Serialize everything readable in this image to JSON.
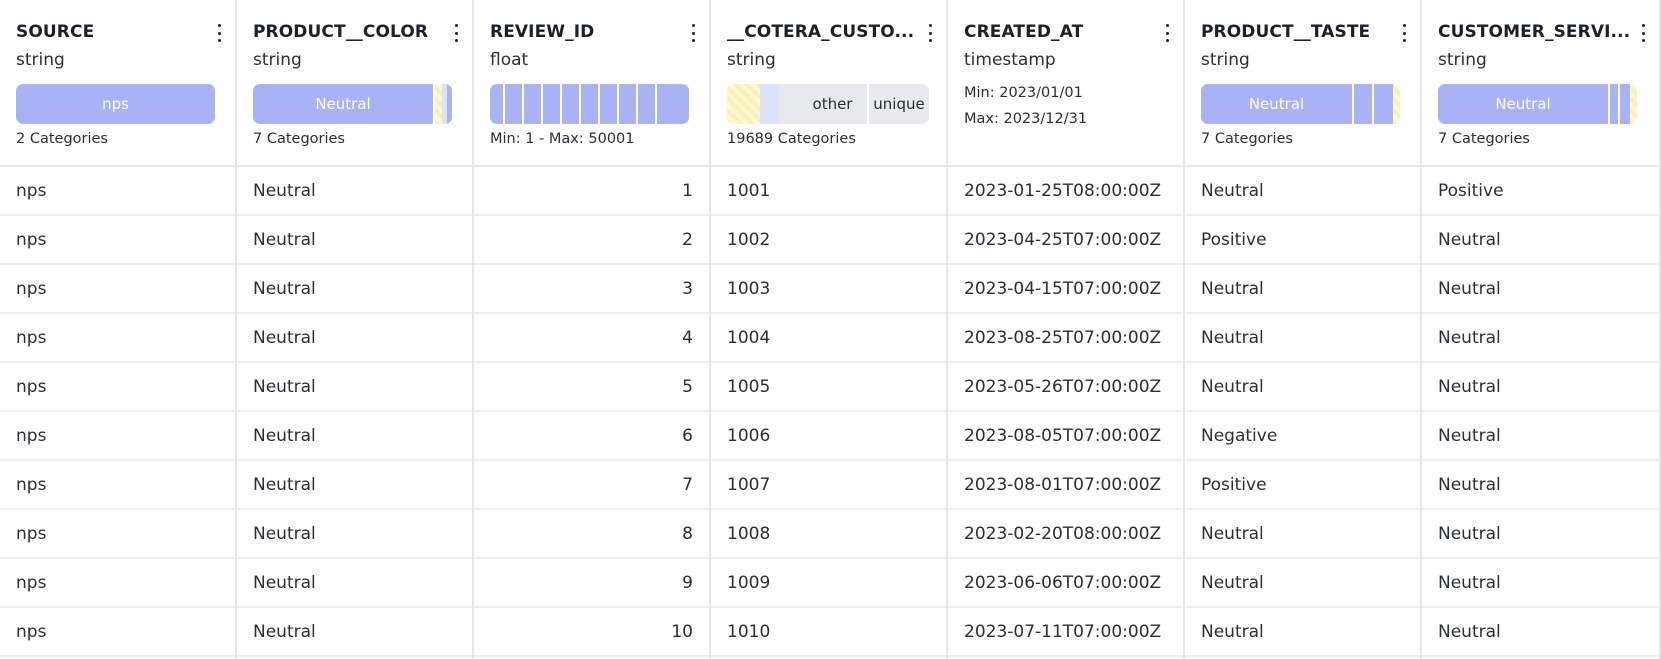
{
  "columns": [
    {
      "name": "SOURCE",
      "type": "string",
      "summary": "2 Categories",
      "bar_label": "nps",
      "values": [
        "nps",
        "nps",
        "nps",
        "nps",
        "nps",
        "nps",
        "nps",
        "nps",
        "nps",
        "nps"
      ]
    },
    {
      "name": "PRODUCT__COLOR",
      "type": "string",
      "summary": "7 Categories",
      "bar_label": "Neutral",
      "values": [
        "Neutral",
        "Neutral",
        "Neutral",
        "Neutral",
        "Neutral",
        "Neutral",
        "Neutral",
        "Neutral",
        "Neutral",
        "Neutral"
      ]
    },
    {
      "name": "REVIEW_ID",
      "type": "float",
      "summary": "Min: 1 - Max: 50001",
      "values": [
        "1",
        "2",
        "3",
        "4",
        "5",
        "6",
        "7",
        "8",
        "9",
        "10"
      ]
    },
    {
      "name": "__COTERA_CUSTO...",
      "type": "string",
      "summary": "19689 Categories",
      "bar_labels": [
        "other",
        "unique"
      ],
      "values": [
        "1001",
        "1002",
        "1003",
        "1004",
        "1005",
        "1006",
        "1007",
        "1008",
        "1009",
        "1010"
      ]
    },
    {
      "name": "CREATED_AT",
      "type": "timestamp",
      "min": "Min: 2023/01/01",
      "max": "Max: 2023/12/31",
      "values": [
        "2023-01-25T08:00:00Z",
        "2023-04-25T07:00:00Z",
        "2023-04-15T07:00:00Z",
        "2023-08-25T07:00:00Z",
        "2023-05-26T07:00:00Z",
        "2023-08-05T07:00:00Z",
        "2023-08-01T07:00:00Z",
        "2023-02-20T08:00:00Z",
        "2023-06-06T07:00:00Z",
        "2023-07-11T07:00:00Z"
      ]
    },
    {
      "name": "PRODUCT__TASTE",
      "type": "string",
      "summary": "7 Categories",
      "bar_label": "Neutral",
      "values": [
        "Neutral",
        "Positive",
        "Neutral",
        "Neutral",
        "Neutral",
        "Negative",
        "Positive",
        "Neutral",
        "Neutral",
        "Neutral"
      ]
    },
    {
      "name": "CUSTOMER_SERVI...",
      "type": "string",
      "summary": "7 Categories",
      "bar_label": "Neutral",
      "values": [
        "Positive",
        "Neutral",
        "Neutral",
        "Neutral",
        "Neutral",
        "Neutral",
        "Neutral",
        "Neutral",
        "Neutral",
        "Neutral"
      ]
    }
  ],
  "icons": {
    "column_menu": "more-vertical-icon"
  },
  "colors": {
    "category_bar": "#a7b3f5",
    "other_bar": "#e8e9ed",
    "striped": "#fbefb2",
    "grid_line": "#e4e6ec",
    "text": "#2a2e3b"
  }
}
